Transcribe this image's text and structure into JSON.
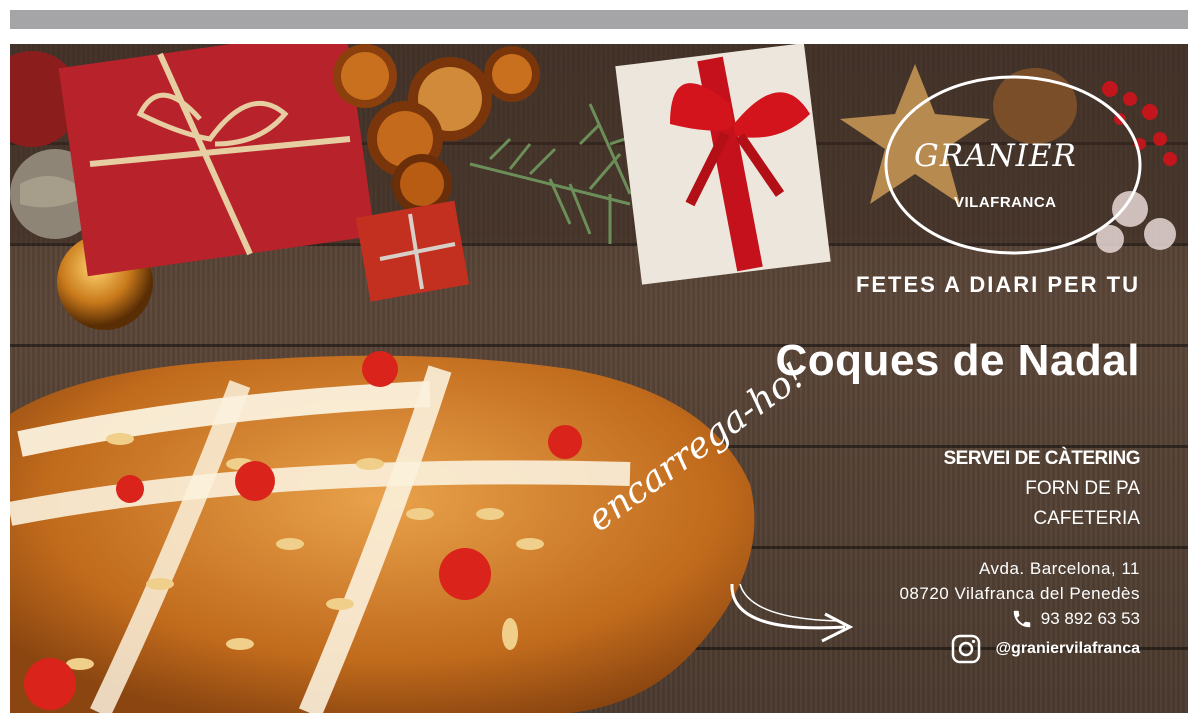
{
  "colors": {
    "background": "#ffffff",
    "top_bar": "#a5a5a7",
    "text": "#ffffff",
    "wood": "#4a3a30",
    "gift_red": "#c0392b"
  },
  "logo": {
    "name": "GRANIER",
    "location": "VILAFRANCA"
  },
  "tagline": "FETES A DIARI PER TU",
  "headline": "Coques de Nadal",
  "cta_script": "encarrega-ho!",
  "services": [
    "SERVEI DE CÀTERING",
    "FORN DE PA",
    "CAFETERIA"
  ],
  "address": {
    "street": "Avda. Barcelona, 11",
    "city": "08720 Vilafranca del Penedès"
  },
  "contact": {
    "phone": "93 892 63 53",
    "phone_icon": "phone-icon",
    "instagram": "@granier­vilafranca",
    "instagram_icon": "instagram-icon"
  }
}
